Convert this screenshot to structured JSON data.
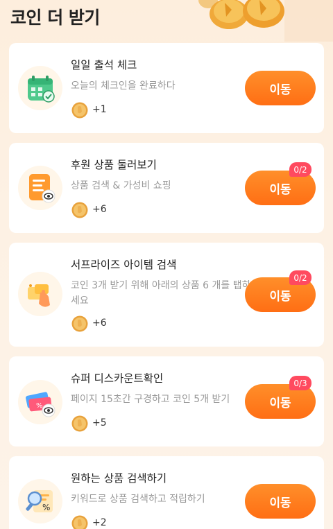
{
  "header": {
    "title": "코인 더 받기"
  },
  "tasks": [
    {
      "title": "일일 출석 체크",
      "desc": "오늘의 체크인을 완료하다",
      "reward": "+1",
      "button": "이동",
      "progress": "",
      "icon": "calendar-check-icon"
    },
    {
      "title": "후원 상품 둘러보기",
      "desc": "상품 검색 & 가성비 쇼핑",
      "reward": "+6",
      "button": "이동",
      "progress": "0/2",
      "icon": "document-eye-icon"
    },
    {
      "title": "서프라이즈 아이템 검색",
      "desc": "코인 3개 받기 위해 아래의 상품 6 개를 탭하세요",
      "reward": "+6",
      "button": "이동",
      "progress": "0/2",
      "icon": "gift-tap-icon"
    },
    {
      "title": "슈퍼 디스카운트확인",
      "desc": "페이지 15초간 구경하고 코인 5개 받기",
      "reward": "+5",
      "button": "이동",
      "progress": "0/3",
      "icon": "coupon-eye-icon"
    },
    {
      "title": "원하는 상품 검색하기",
      "desc": "키워드로 상품 검색하고 적립하기",
      "reward": "+2",
      "button": "이동",
      "progress": "",
      "icon": "search-percent-icon"
    }
  ],
  "colors": {
    "accent": "#ff7a1f",
    "badge": "#ff4a5f",
    "coin": "#f0b04a",
    "background": "#fdf0e2"
  }
}
